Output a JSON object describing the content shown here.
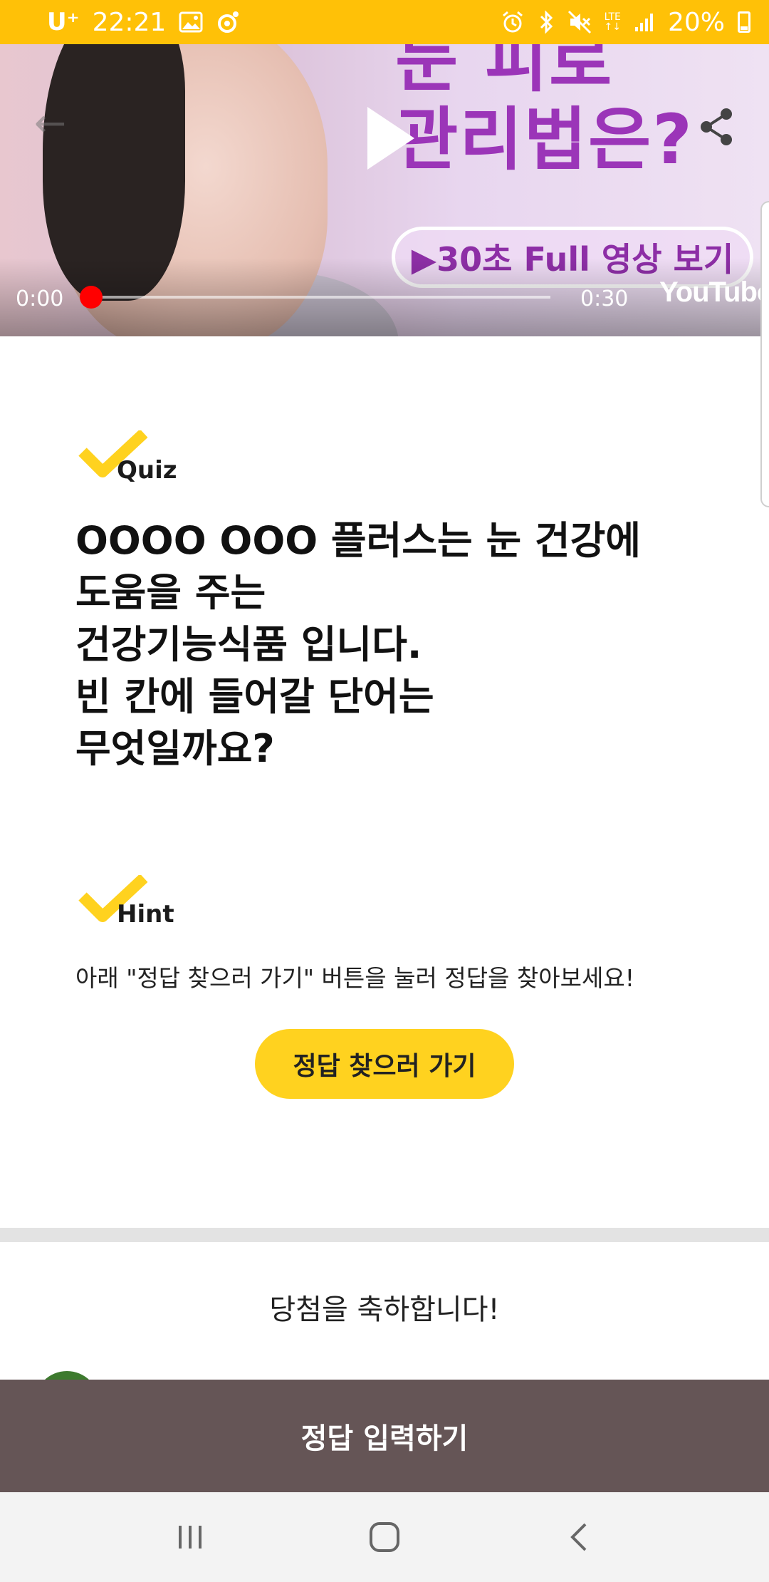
{
  "status_bar": {
    "carrier": "U⁺",
    "time": "22:21",
    "network": "LTE",
    "battery": "20%",
    "icons": [
      "gallery-icon",
      "app-notification-icon",
      "alarm-icon",
      "bluetooth-icon",
      "mute-icon",
      "lte-icon",
      "signal-icon",
      "battery-icon"
    ]
  },
  "video": {
    "promo_title_line1": "눈 피로",
    "promo_title_line2": "관리법은?",
    "promo_button": "▶30초 Full 영상 보기",
    "current_time": "0:00",
    "duration": "0:30",
    "progress": 0,
    "brand": "YouTube",
    "colors": {
      "promo_purple": "#9b35b8",
      "progress_red": "#ff0000"
    }
  },
  "quiz": {
    "label": "Quiz",
    "question_lines": [
      "OOOO OOO 플러스는 눈 건강에",
      "도움을 주는",
      "건강기능식품 입니다.",
      "빈 칸에 들어갈 단어는",
      "무엇일까요?"
    ]
  },
  "hint": {
    "label": "Hint",
    "text": "아래 \"정답 찾으러 가기\" 버튼을 눌러 정답을 찾아보세요!",
    "button": "정답 찾으러 가기"
  },
  "winners": {
    "title": "당첨을 축하합니다!"
  },
  "bottom_bar": {
    "button": "정답 입력하기"
  },
  "accent_color": "#FFC107",
  "nav_bar": {
    "icons": [
      "recent-apps-icon",
      "home-icon",
      "back-icon"
    ]
  }
}
